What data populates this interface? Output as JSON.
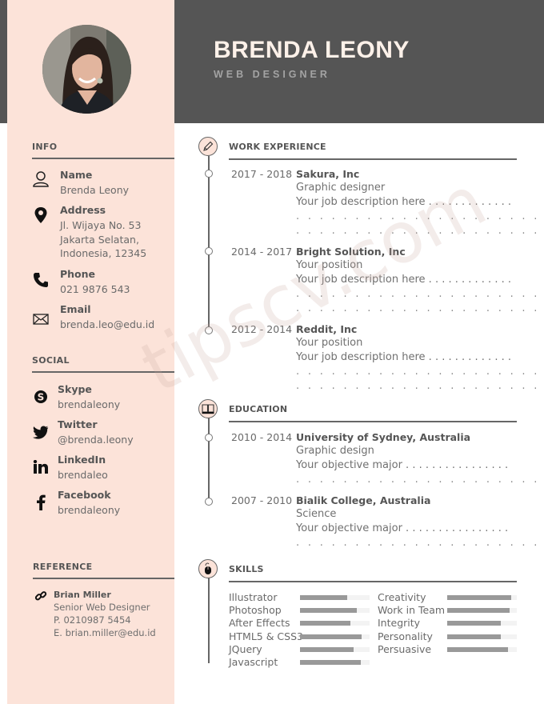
{
  "header": {
    "name": "BRENDA LEONY",
    "role": "WEB DESIGNER"
  },
  "colors": {
    "header_bg": "#555555",
    "sidebar_bg": "#fce3d9",
    "name_text": "#fdf1e9",
    "bar_fill": "#999999",
    "bar_track": "#f3f3f3"
  },
  "sidebar": {
    "info": {
      "title": "INFO",
      "items": [
        {
          "icon": "user-icon",
          "label": "Name",
          "value": "Brenda Leony"
        },
        {
          "icon": "map-pin-icon",
          "label": "Address",
          "value_lines": [
            "Jl. Wijaya No. 53",
            "Jakarta Selatan,",
            "Indonesia, 12345"
          ]
        },
        {
          "icon": "phone-icon",
          "label": "Phone",
          "value": "021 9876 543"
        },
        {
          "icon": "envelope-icon",
          "label": "Email",
          "value": "brenda.leo@edu.id"
        }
      ]
    },
    "social": {
      "title": "SOCIAL",
      "items": [
        {
          "icon": "skype-icon",
          "label": "Skype",
          "value": "brendaleony"
        },
        {
          "icon": "twitter-icon",
          "label": "Twitter",
          "value": "@brenda.leony"
        },
        {
          "icon": "linkedin-icon",
          "label": "LinkedIn",
          "value": "brendaleo"
        },
        {
          "icon": "facebook-icon",
          "label": "Facebook",
          "value": "brendaleony"
        }
      ]
    },
    "reference": {
      "title": "REFERENCE",
      "icon": "link-icon",
      "name": "Brian Miller",
      "position": "Senior Web Designer",
      "phone": "P. 0210987 5454",
      "email": "E. brian.miller@edu.id"
    }
  },
  "work": {
    "title": "WORK EXPERIENCE",
    "icon": "pencil-icon",
    "entries": [
      {
        "years": "2017 - 2018",
        "org": "Sakura, Inc",
        "position": "Graphic designer",
        "desc": "Your job description here . . . . . . . . . . . . .",
        "dots": [
          ". . . . . . . . . . . . . . . . . . . . . . . . . . . . . . . . .",
          ". . . . . . . . . . . . . . . . . . . . . . . . . . . . . . . . ."
        ]
      },
      {
        "years": "2014 - 2017",
        "org": "Bright Solution, Inc",
        "position": "Your position",
        "desc": "Your job description here . . . . . . . . . . . . .",
        "dots": [
          ". . . . . . . . . . . . . . . . . . . . . . . . . . . . . . . . .",
          ". . . . . . . . . . . . . . . . . . . . . . . . . . . . . . . . ."
        ]
      },
      {
        "years": "2012 - 2014",
        "org": "Reddit, Inc",
        "position": "Your position",
        "desc": "Your job description here . . . . . . . . . . . . .",
        "dots": [
          ". . . . . . . . . . . . . . . . . . . . . . . . . . . . . . . . .",
          ". . . . . . . . . . . . . . . . . . . . . . . . . . . . . . . . ."
        ]
      }
    ]
  },
  "education": {
    "title": "EDUCATION",
    "icon": "book-icon",
    "entries": [
      {
        "years": "2010 - 2014",
        "org": "University of Sydney, Australia",
        "field": "Graphic design",
        "desc": "Your objective major . . . . . . . . . . . . . . . .",
        "dots": [
          ". . . . . . . . . . . . . . . . . . . . . . . . . . . . . . . . ."
        ]
      },
      {
        "years": "2007 - 2010",
        "org": "Bialik College, Australia",
        "field": "Science",
        "desc": "Your objective major . . . . . . . . . . . . . . . .",
        "dots": [
          ". . . . . . . . . . . . . . . . . . . . . . . . . . . . . . . . ."
        ]
      }
    ]
  },
  "skills": {
    "title": "SKILLS",
    "icon": "mouse-icon",
    "left": [
      {
        "name": "Illustrator",
        "level": 0.68
      },
      {
        "name": "Photoshop",
        "level": 0.82
      },
      {
        "name": "After Effects",
        "level": 0.72
      },
      {
        "name": "HTML5 & CSS3",
        "level": 0.88
      },
      {
        "name": "JQuery",
        "level": 0.77
      },
      {
        "name": "Javascript",
        "level": 0.87
      }
    ],
    "right": [
      {
        "name": "Creativity",
        "level": 0.92
      },
      {
        "name": "Work in Team",
        "level": 0.9
      },
      {
        "name": "Integrity",
        "level": 0.77
      },
      {
        "name": "Personality",
        "level": 0.77
      },
      {
        "name": "Persuasive",
        "level": 0.87
      }
    ]
  },
  "watermark": "tipscv.com"
}
